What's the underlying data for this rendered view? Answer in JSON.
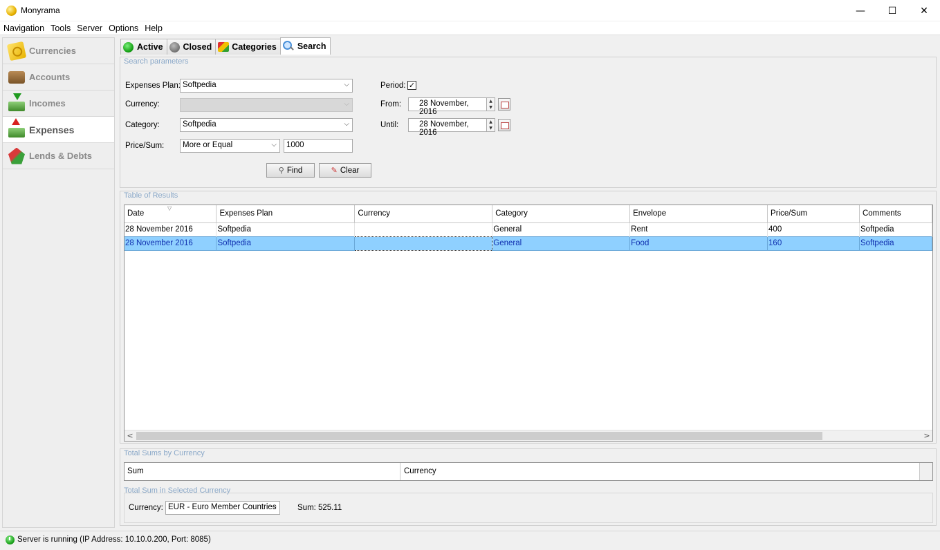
{
  "window": {
    "title": "Monyrama",
    "minimize_glyph": "—",
    "maximize_glyph": "☐",
    "close_glyph": "✕"
  },
  "menu": [
    "Navigation",
    "Tools",
    "Server",
    "Options",
    "Help"
  ],
  "sidebar": {
    "items": [
      {
        "label": "Currencies",
        "icon": "currencies-icon"
      },
      {
        "label": "Accounts",
        "icon": "wallet-icon"
      },
      {
        "label": "Incomes",
        "icon": "incomes-icon"
      },
      {
        "label": "Expenses",
        "icon": "expenses-icon",
        "active": true
      },
      {
        "label": "Lends & Debts",
        "icon": "lends-debts-icon"
      }
    ]
  },
  "tabs": [
    {
      "label": "Active",
      "icon": "green-dot-icon"
    },
    {
      "label": "Closed",
      "icon": "gray-dot-icon"
    },
    {
      "label": "Categories",
      "icon": "categories-icon"
    },
    {
      "label": "Search",
      "icon": "magnifier-icon",
      "selected": true
    }
  ],
  "search": {
    "legend": "Search parameters",
    "expenses_plan_label": "Expenses Plan:",
    "expenses_plan_value": "Softpedia",
    "currency_label": "Currency:",
    "currency_value": "",
    "category_label": "Category:",
    "category_value": "Softpedia",
    "price_label": "Price/Sum:",
    "price_operator": "More or Equal",
    "price_value": "1000",
    "period_label": "Period:",
    "period_checked": true,
    "period_check_glyph": "✓",
    "from_label": "From:",
    "from_value": "28 November, 2016",
    "until_label": "Until:",
    "until_value": "28 November, 2016",
    "find_label": "Find",
    "clear_label": "Clear",
    "dropdown_glyph": "⌵",
    "spin_up_glyph": "▲",
    "spin_down_glyph": "▼"
  },
  "results": {
    "legend": "Table of Results",
    "sort_glyph": "▽",
    "scroll_left_glyph": "<",
    "scroll_right_glyph": ">",
    "columns": [
      "Date",
      "Expenses Plan",
      "Currency",
      "Category",
      "Envelope",
      "Price/Sum",
      "Comments"
    ],
    "rows": [
      [
        "28 November 2016",
        "Softpedia",
        "",
        "General",
        "Rent",
        "400",
        "Softpedia"
      ],
      [
        "28 November 2016",
        "Softpedia",
        "",
        "General",
        "Food",
        "160",
        "Softpedia"
      ]
    ],
    "selected_row": 1
  },
  "totals": {
    "legend": "Total Sums by Currency",
    "col_sum": "Sum",
    "col_currency": "Currency",
    "selected_legend": "Total Sum in Selected Currency",
    "currency_label": "Currency:",
    "currency_value": "EUR - Euro Member Countries",
    "sum_label": "Sum:",
    "sum_value": "525.11"
  },
  "status": {
    "text": "Server is running (IP Address: 10.10.0.200, Port: 8085)"
  }
}
